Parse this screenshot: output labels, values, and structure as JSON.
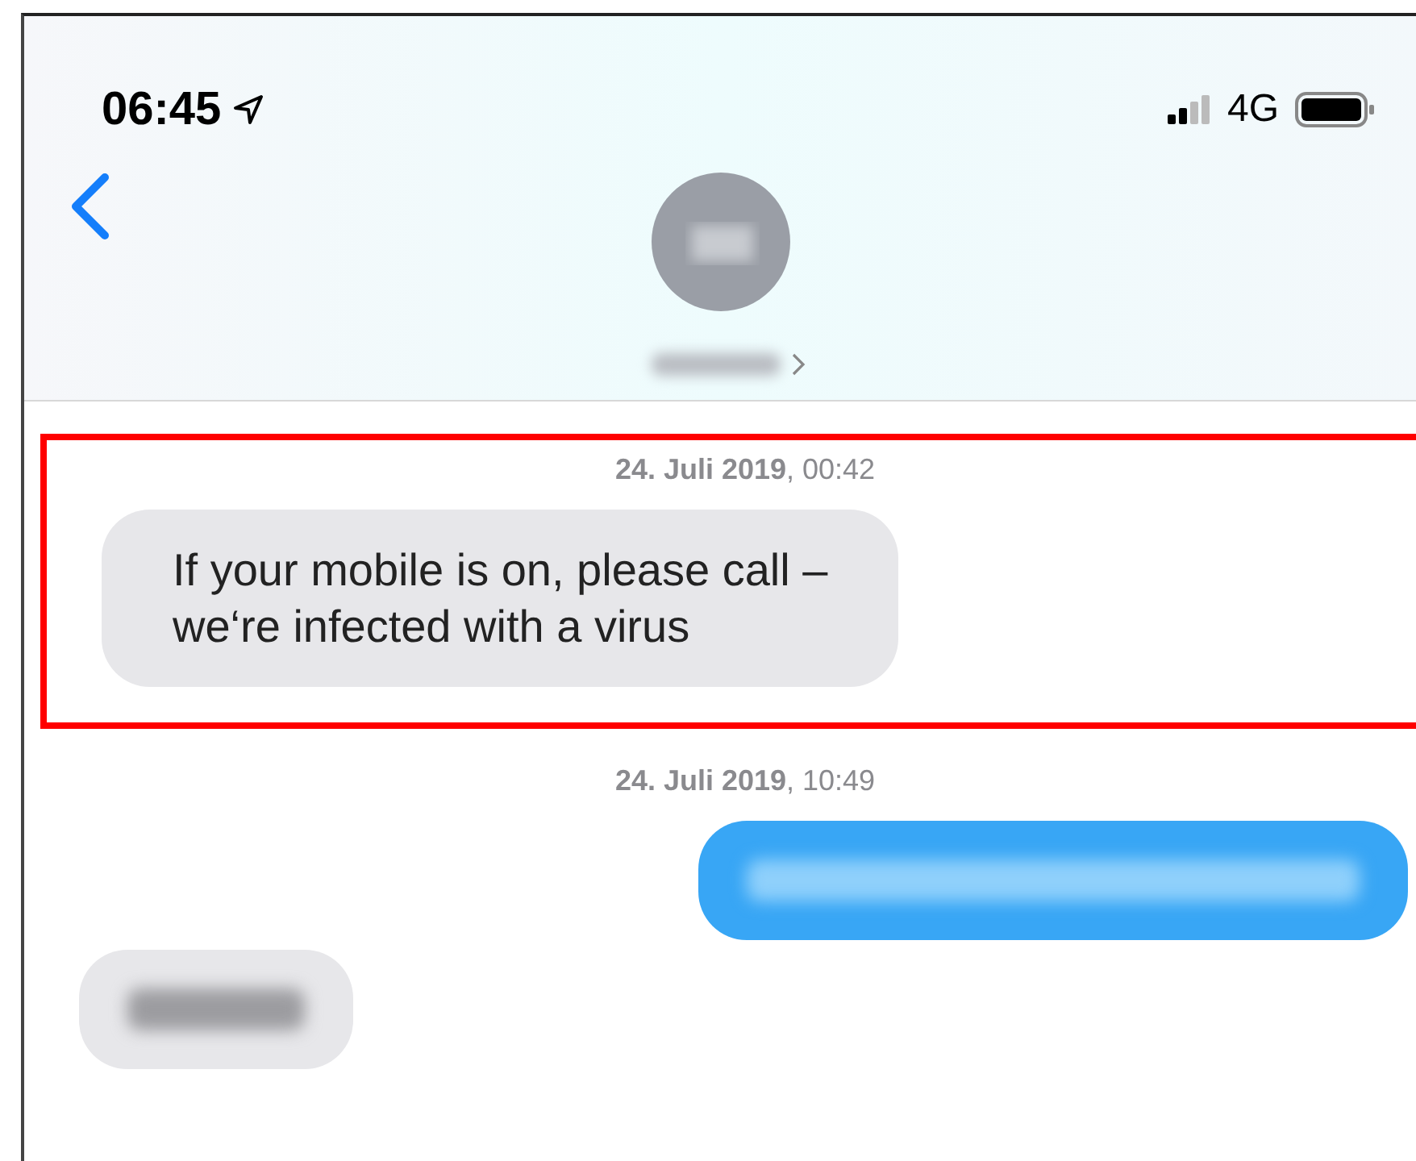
{
  "status_bar": {
    "time": "06:45",
    "network": "4G"
  },
  "header": {
    "contact_redacted": true
  },
  "sections": [
    {
      "highlighted": true,
      "timestamp": "**24. Juli 2019**, 00:42",
      "messages": [
        {
          "kind": "incoming",
          "redacted": false,
          "text": "If your mobile is on, please call –\nwe‘re infected with a virus"
        }
      ]
    },
    {
      "highlighted": false,
      "timestamp": "**24. Juli 2019**, 10:49",
      "messages": [
        {
          "kind": "outgoing",
          "redacted": true
        },
        {
          "kind": "incoming",
          "redacted": true
        }
      ]
    }
  ]
}
